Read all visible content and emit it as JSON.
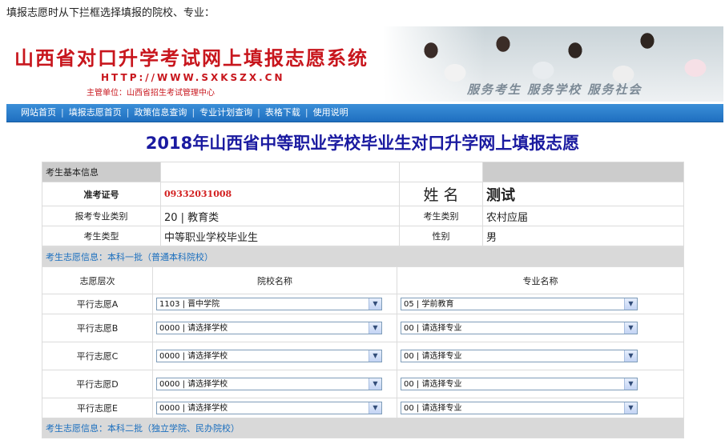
{
  "top_note": "填报志愿时从下拦框选择填报的院校、专业：",
  "banner": {
    "title": "山西省对口升学考试网上填报志愿系统",
    "url": "HTTP://WWW.SXKSZX.CN",
    "org": "主管单位：山西省招生考试管理中心",
    "slogan": "服务考生  服务学校  服务社会"
  },
  "nav": [
    "网站首页",
    "填报志愿首页",
    "政策信息查询",
    "专业计划查询",
    "表格下载",
    "使用说明"
  ],
  "page_title": "2018年山西省中等职业学校毕业生对口升学网上填报志愿",
  "basic": {
    "section_label": "考生基本信息",
    "exam_no_label": "准考证号",
    "exam_no": "09332031008",
    "name_label": "姓 名",
    "name": "测试",
    "major_cat_label": "报考专业类别",
    "major_cat": "20 | 教育类",
    "stu_cat_label": "考生类别",
    "stu_cat": "农村应届",
    "stu_type_label": "考生类型",
    "stu_type": "中等职业学校毕业生",
    "gender_label": "性别",
    "gender": "男"
  },
  "batch1": {
    "section_label": "考生志愿信息：本科一批（普通本科院校）",
    "col_level": "志愿层次",
    "col_school": "院校名称",
    "col_major": "专业名称",
    "rows": [
      {
        "level": "平行志愿A",
        "school": "1103 | 晋中学院",
        "major": "05 | 学前教育"
      },
      {
        "level": "平行志愿B",
        "school": "0000 | 请选择学校",
        "major": "00 | 请选择专业"
      },
      {
        "level": "平行志愿C",
        "school": "0000 | 请选择学校",
        "major": "00 | 请选择专业"
      },
      {
        "level": "平行志愿D",
        "school": "0000 | 请选择学校",
        "major": "00 | 请选择专业"
      },
      {
        "level": "平行志愿E",
        "school": "0000 | 请选择学校",
        "major": "00 | 请选择专业"
      }
    ]
  },
  "batch2": {
    "section_label": "考生志愿信息：本科二批（独立学院、民办院校）"
  },
  "colors": {
    "title_red": "#c8161d",
    "nav_blue": "#1f6fc0",
    "heading_blue": "#1a1aa0",
    "exam_red": "#d21f1f"
  }
}
